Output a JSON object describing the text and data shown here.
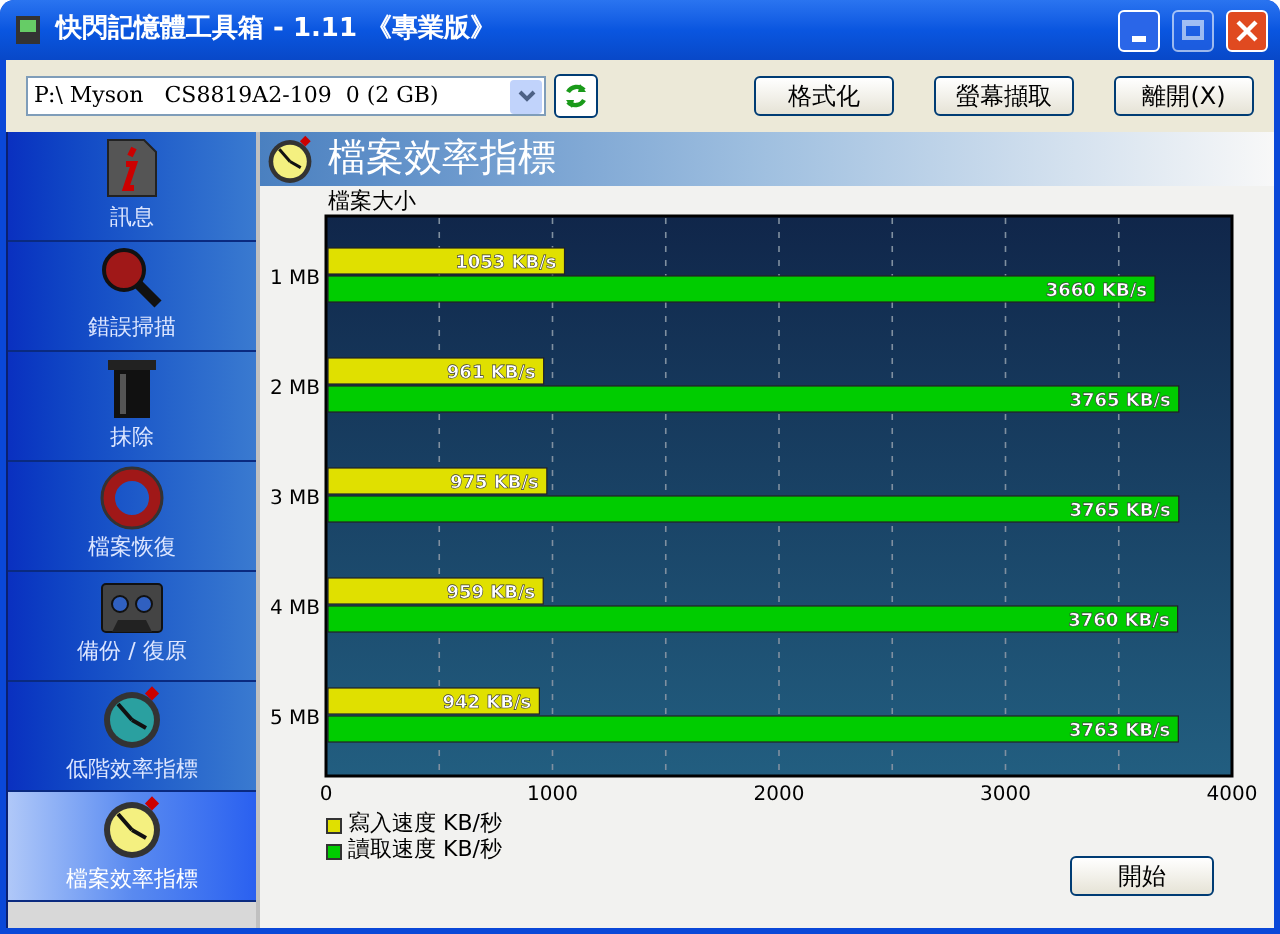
{
  "window": {
    "title": "快閃記憶體工具箱 - 1.11 《專業版》"
  },
  "toolbar": {
    "device": "P:\\ Myson   CS8819A2-109  0 (2 GB)",
    "buttons": [
      "格式化",
      "螢幕擷取",
      "離開(X)"
    ]
  },
  "sidebar": {
    "items": [
      {
        "label": "訊息",
        "kind": "info",
        "selected": false
      },
      {
        "label": "錯誤掃描",
        "kind": "scan",
        "selected": false
      },
      {
        "label": "抹除",
        "kind": "erase",
        "selected": false
      },
      {
        "label": "檔案恢復",
        "kind": "recover",
        "selected": false
      },
      {
        "label": "備份 / 復原",
        "kind": "backup",
        "selected": false
      },
      {
        "label": "低階效率指標",
        "kind": "lowbench",
        "selected": false
      },
      {
        "label": "檔案效率指標",
        "kind": "filebench",
        "selected": true
      }
    ]
  },
  "panel": {
    "title": "檔案效率指標",
    "chart_data": {
      "type": "bar",
      "orientation": "horizontal",
      "ylabel": "檔案大小",
      "categories": [
        "1 MB",
        "2 MB",
        "3 MB",
        "4 MB",
        "5 MB"
      ],
      "series": [
        {
          "name": "寫入速度 KB/秒",
          "color": "#e0e000",
          "values": [
            1053,
            961,
            975,
            959,
            942
          ]
        },
        {
          "name": "讀取速度 KB/秒",
          "color": "#00cc00",
          "values": [
            3660,
            3765,
            3765,
            3760,
            3763
          ]
        }
      ],
      "value_labels": [
        [
          "1053 KB/s",
          "961 KB/s",
          "975 KB/s",
          "959 KB/s",
          "942 KB/s"
        ],
        [
          "3660 KB/s",
          "3765 KB/s",
          "3765 KB/s",
          "3760 KB/s",
          "3763 KB/s"
        ]
      ],
      "grid": true,
      "xlim": [
        0,
        4000
      ],
      "xticks": [
        0,
        1000,
        2000,
        3000,
        4000
      ]
    },
    "start_button": "開始"
  }
}
